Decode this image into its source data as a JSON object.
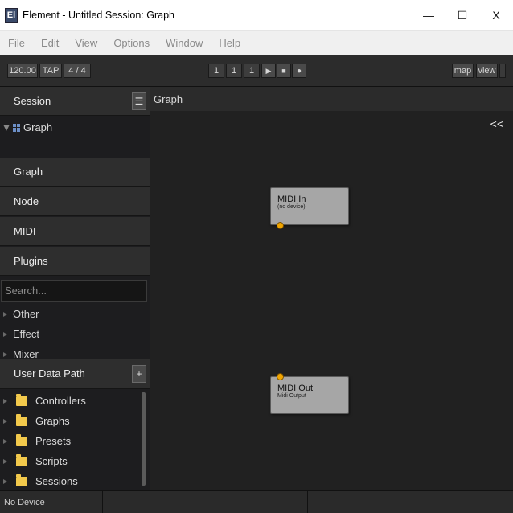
{
  "window": {
    "icon_text": "El",
    "title": "Element - Untitled Session: Graph",
    "minimize": "—",
    "maximize": "☐",
    "close": "X"
  },
  "menu": [
    "File",
    "Edit",
    "View",
    "Options",
    "Window",
    "Help"
  ],
  "toolbar": {
    "tempo": "120.00",
    "tap": "TAP",
    "meter": "4 / 4",
    "bar": "1",
    "beat": "1",
    "tick": "1",
    "play_icon": "▶",
    "stop_icon": "■",
    "record_icon": "●",
    "map": "map",
    "view": "view"
  },
  "sidebar": {
    "session_title": "Session",
    "menu_icon": "☰",
    "tree_root": "Graph",
    "sections": [
      "Graph",
      "Node",
      "MIDI",
      "Plugins"
    ],
    "search_placeholder": "Search...",
    "categories": [
      "Other",
      "Effect",
      "Mixer"
    ],
    "user_data_title": "User Data Path",
    "add_icon": "+",
    "folders": [
      "Controllers",
      "Graphs",
      "Presets",
      "Scripts",
      "Sessions"
    ]
  },
  "graph": {
    "header": "Graph",
    "collapse": "<<",
    "nodes": [
      {
        "title": "MIDI In",
        "subtitle": "(no device)"
      },
      {
        "title": "MIDI Out",
        "subtitle": "Midi Output"
      }
    ]
  },
  "status": {
    "device": "No Device"
  }
}
